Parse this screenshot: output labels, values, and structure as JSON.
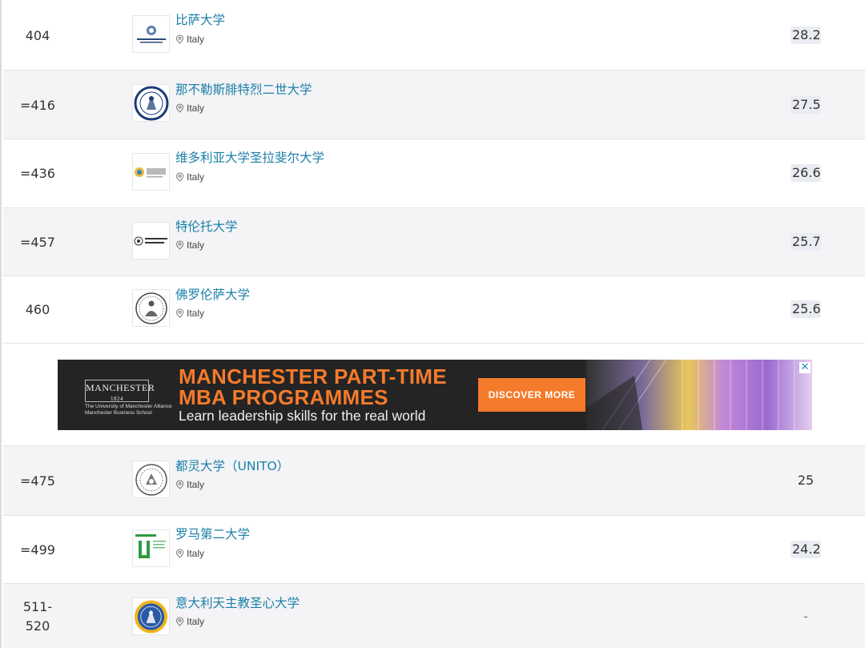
{
  "rankings": [
    {
      "rank": "404",
      "name": "比萨大学",
      "location": "Italy",
      "score": "28.2",
      "logo_icon": "university-of-pisa-logo"
    },
    {
      "rank": "=416",
      "name": "那不勒斯腓特烈二世大学",
      "location": "Italy",
      "score": "27.5",
      "logo_icon": "naples-federico-ii-seal"
    },
    {
      "rank": "=436",
      "name": "维多利亚大学圣拉斐尔大学",
      "location": "Italy",
      "score": "26.6",
      "logo_icon": "unisr-logo"
    },
    {
      "rank": "=457",
      "name": "特伦托大学",
      "location": "Italy",
      "score": "25.7",
      "logo_icon": "university-of-trento-logo"
    },
    {
      "rank": "460",
      "name": "佛罗伦萨大学",
      "location": "Italy",
      "score": "25.6",
      "logo_icon": "florence-seal"
    },
    {
      "rank": "=475",
      "name": "都灵大学（UNITO）",
      "location": "Italy",
      "score": "25",
      "logo_icon": "turin-seal"
    },
    {
      "rank": "=499",
      "name": "罗马第二大学",
      "location": "Italy",
      "score": "24.2",
      "logo_icon": "tor-vergata-logo"
    },
    {
      "rank": "511-\n520",
      "name": "意大利天主教圣心大学",
      "location": "Italy",
      "score": "-",
      "logo_icon": "sacred-heart-seal"
    }
  ],
  "ad": {
    "logo_text": "MANCHESTER",
    "logo_year": "1824",
    "logo_sub": "The University of Manchester Alliance Manchester Business School",
    "headline_1": "MANCHESTER PART-TIME",
    "headline_2": "MBA PROGRAMMES",
    "tagline": "Learn leadership skills for the real world",
    "cta": "DISCOVER MORE",
    "close": "✕"
  },
  "colors": {
    "link": "#1a7fa8",
    "score_bg": "#e9ecf2",
    "alt_row": "#f4f4f6",
    "ad_orange": "#f47b2b",
    "ad_bg": "#242424"
  }
}
